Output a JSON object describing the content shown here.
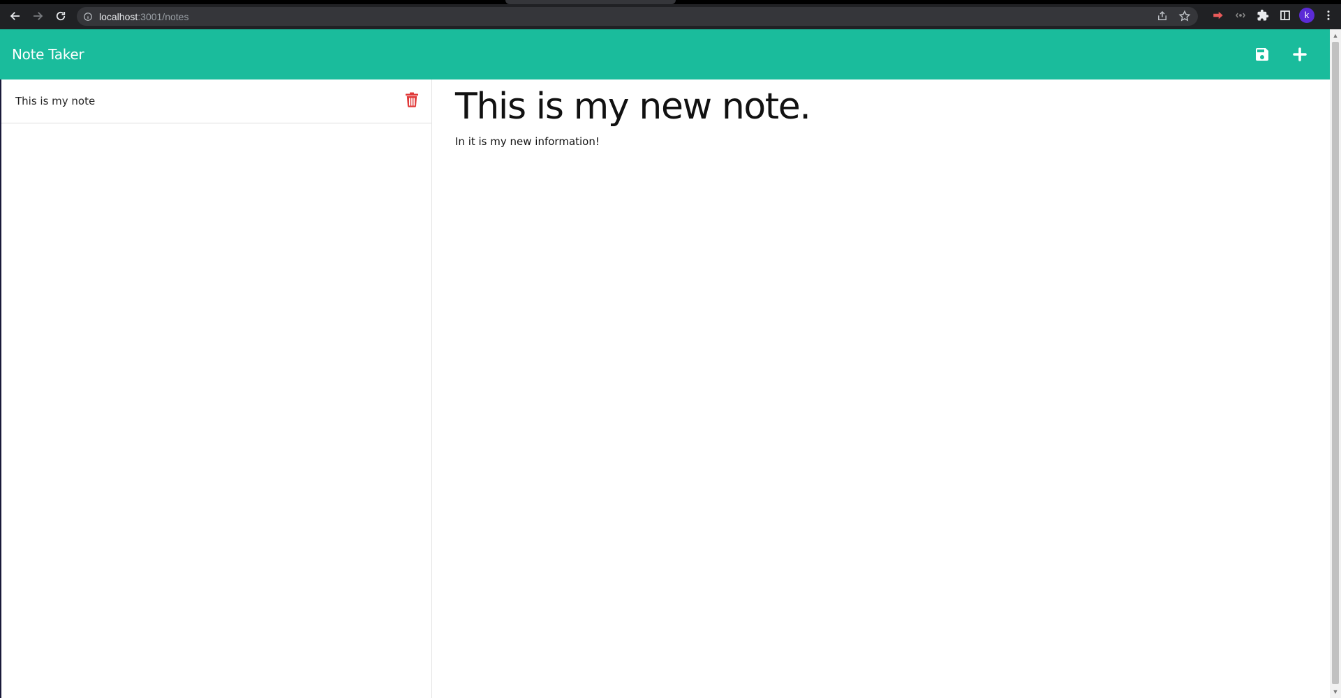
{
  "browser": {
    "url_host": "localhost",
    "url_path": ":3001/notes",
    "profile_initial": "k",
    "icons": {
      "back": "arrow-left-icon",
      "forward": "arrow-right-icon",
      "reload": "reload-icon",
      "site_info": "info-icon",
      "share": "share-icon",
      "bookmark": "star-icon",
      "extension1": "extension-icon",
      "extension2": "extension-icon",
      "extensions": "puzzle-icon",
      "side_panel": "side-panel-icon",
      "menu": "kebab-menu-icon"
    }
  },
  "app": {
    "brand": "Note Taker",
    "accent_color": "#1abc9c",
    "icons": {
      "save": "save-icon",
      "new_note": "plus-icon",
      "delete": "trash-icon"
    }
  },
  "sidebar": {
    "notes": [
      {
        "title": "This is my note"
      }
    ]
  },
  "editor": {
    "title": "This is my new note.",
    "text": "In it is my new information!"
  }
}
